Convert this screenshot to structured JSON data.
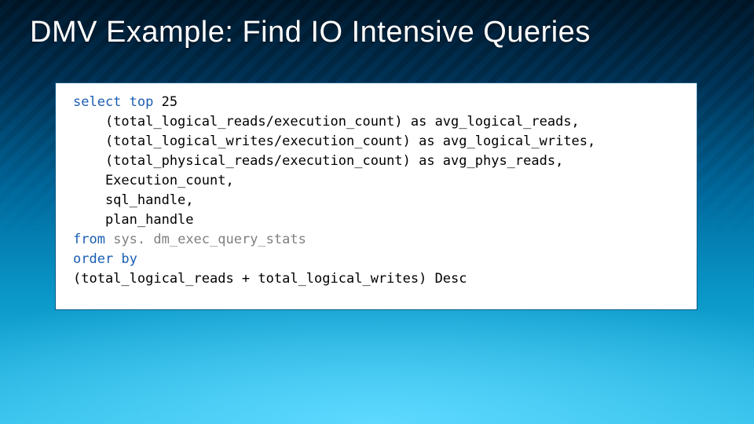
{
  "title": "DMV Example: Find IO Intensive Queries",
  "code": {
    "l01_kw1": "select",
    "l01_kw2": "top",
    "l01_rest": " 25",
    "l02": "    (total_logical_reads/execution_count) as avg_logical_reads,",
    "l03": "    (total_logical_writes/execution_count) as avg_logical_writes,",
    "l04": "    (total_physical_reads/execution_count) as avg_phys_reads,",
    "l05": "    Execution_count,",
    "l06": "    sql_handle,",
    "l07": "    plan_handle",
    "l08_kw": "from",
    "l08_gray": "sys. dm_exec_query_stats",
    "l09_kw": "order by",
    "l10": "(total_logical_reads + total_logical_writes) Desc"
  }
}
